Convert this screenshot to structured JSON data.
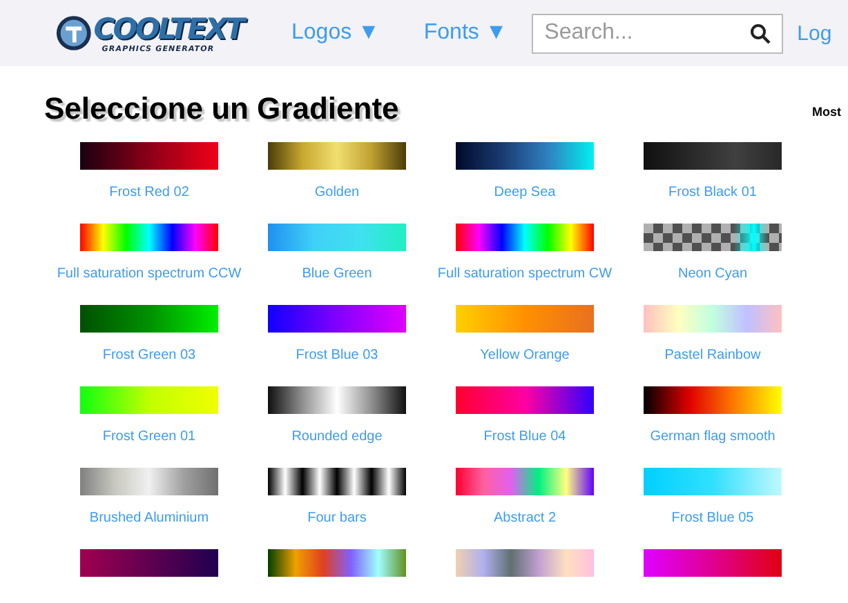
{
  "header": {
    "logo": {
      "title": "COOLTEXT",
      "subtitle": "GRAPHICS GENERATOR"
    },
    "menus": [
      {
        "label": "Logos",
        "caret": "▼"
      },
      {
        "label": "Fonts",
        "caret": "▼"
      }
    ],
    "search": {
      "placeholder": "Search..."
    },
    "login": "Log"
  },
  "heading": "Seleccione un Gradiente",
  "sidebar": {
    "title": "Most"
  },
  "gradients": [
    {
      "kind": "gradient",
      "label": "Frost Red 02"
    },
    {
      "kind": "gradient",
      "label": "Golden"
    },
    {
      "kind": "gradient",
      "label": "Deep Sea"
    },
    {
      "kind": "gradient",
      "label": "Frost Black 01"
    },
    {
      "kind": "gradient",
      "label": "Full saturation spectrum CCW"
    },
    {
      "kind": "gradient",
      "label": "Blue Green"
    },
    {
      "kind": "gradient",
      "label": "Full saturation spectrum CW"
    },
    {
      "kind": "checker",
      "label": "Neon Cyan"
    },
    {
      "kind": "gradient",
      "label": "Frost Green 03"
    },
    {
      "kind": "gradient",
      "label": "Frost Blue 03"
    },
    {
      "kind": "gradient",
      "label": "Yellow Orange"
    },
    {
      "kind": "gradient",
      "label": "Pastel Rainbow"
    },
    {
      "kind": "gradient",
      "label": "Frost Green 01"
    },
    {
      "kind": "gradient",
      "label": "Rounded edge"
    },
    {
      "kind": "gradient",
      "label": "Frost Blue 04"
    },
    {
      "kind": "gradient",
      "label": "German flag smooth"
    },
    {
      "kind": "gradient",
      "label": "Brushed Aluminium"
    },
    {
      "kind": "gradient",
      "label": "Four bars"
    },
    {
      "kind": "gradient",
      "label": "Abstract 2"
    },
    {
      "kind": "gradient",
      "label": "Frost Blue 05"
    },
    {
      "kind": "gradient"
    },
    {
      "kind": "gradient"
    },
    {
      "kind": "gradient"
    },
    {
      "kind": "gradient"
    }
  ]
}
